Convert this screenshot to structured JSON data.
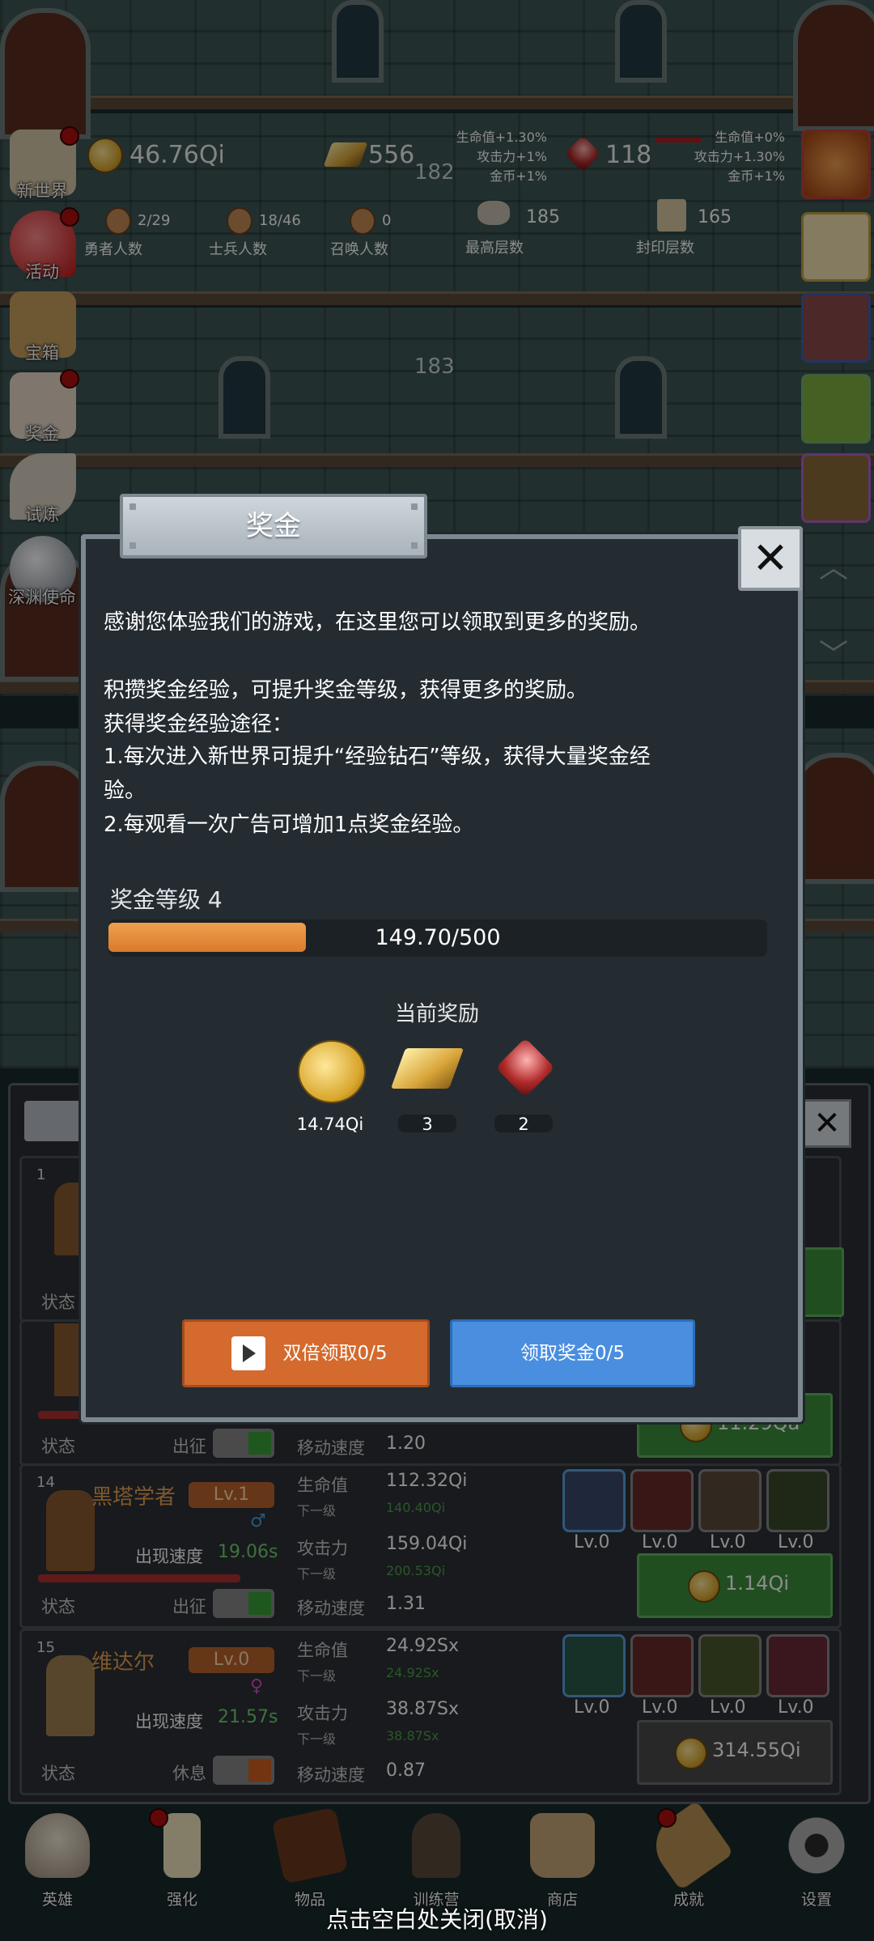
{
  "top_stats": {
    "coins": "46.76Qi",
    "gold_bars": "556",
    "rubies": "118",
    "floor_top": "182",
    "floor_mid": "183",
    "boost_left": [
      "生命值+1.30%",
      "攻击力+1%",
      "金币+1%"
    ],
    "boost_right": [
      "生命值+0%",
      "攻击力+1.30%",
      "金币+1%"
    ],
    "counters": [
      {
        "value": "2/29",
        "label": "勇者人数"
      },
      {
        "value": "18/46",
        "label": "士兵人数"
      },
      {
        "value": "0",
        "label": "召唤人数"
      },
      {
        "value": "185",
        "label": "最高层数"
      },
      {
        "value": "165",
        "label": "封印层数"
      }
    ]
  },
  "side_menu": [
    {
      "label": "新世界",
      "icon": "new-world-icon"
    },
    {
      "label": "活动",
      "icon": "heart-icon"
    },
    {
      "label": "宝箱",
      "icon": "chest-icon"
    },
    {
      "label": "奖金",
      "icon": "envelope-icon"
    },
    {
      "label": "试炼",
      "icon": "feather-icon"
    },
    {
      "label": "深渊使命",
      "icon": "orb-icon"
    }
  ],
  "modal": {
    "title": "奖金",
    "desc1": "感谢您体验我们的游戏，在这里您可以领取到更多的奖励。",
    "desc2": "积攒奖金经验，可提升奖金等级，获得更多的奖励。",
    "desc3": "获得奖金经验途径：",
    "desc4": "1.每次进入新世界可提升“经验钻石”等级，获得大量奖金经",
    "desc5": "验。",
    "desc6": "2.每观看一次广告可增加1点奖金经验。",
    "level_label": "奖金等级 4",
    "progress_current": 149.7,
    "progress_max": 500,
    "progress_text": "149.70/500",
    "reward_title": "当前奖励",
    "rewards": [
      {
        "icon": "coin-icon",
        "value": "14.74Qi"
      },
      {
        "icon": "gold-bar-icon",
        "value": "3"
      },
      {
        "icon": "ruby-icon",
        "value": "2"
      }
    ],
    "btn_double": "双倍领取0/5",
    "btn_claim": "领取奖金0/5"
  },
  "heroes": [
    {
      "index": "1",
      "status": "状态"
    },
    {
      "status": "状态",
      "action": "出征",
      "move_label": "移动速度",
      "move": "1.20",
      "cost": "11.29Qa"
    },
    {
      "index": "14",
      "name": "黑塔学者",
      "level": "Lv.1",
      "speed_label": "出现速度",
      "speed": "19.06s",
      "hp_label": "生命值",
      "hp": "112.32Qi",
      "next_label": "下一级",
      "hp_next": "140.40Qi",
      "atk_label": "攻击力",
      "atk": "159.04Qi",
      "atk_next": "200.53Qi",
      "move_label": "移动速度",
      "move": "1.31",
      "status": "状态",
      "action": "出征",
      "cost": "1.14Qi",
      "skills": [
        "Lv.0",
        "Lv.0",
        "Lv.0",
        "Lv.0"
      ]
    },
    {
      "index": "15",
      "name": "维达尔",
      "level": "Lv.0",
      "speed_label": "出现速度",
      "speed": "21.57s",
      "hp_label": "生命值",
      "hp": "24.92Sx",
      "next_label": "下一级",
      "hp_next": "24.92Sx",
      "atk_label": "攻击力",
      "atk": "38.87Sx",
      "atk_next": "38.87Sx",
      "move_label": "移动速度",
      "move": "0.87",
      "status": "状态",
      "action": "休息",
      "cost": "314.55Qi",
      "skills": [
        "Lv.0",
        "Lv.0",
        "Lv.0",
        "Lv.0"
      ]
    }
  ],
  "bottom_nav": [
    {
      "label": "英雄",
      "icon": "skull-icon"
    },
    {
      "label": "强化",
      "icon": "candle-icon"
    },
    {
      "label": "物品",
      "icon": "book-icon"
    },
    {
      "label": "训练营",
      "icon": "lantern-icon"
    },
    {
      "label": "商店",
      "icon": "mug-icon"
    },
    {
      "label": "成就",
      "icon": "key-icon"
    },
    {
      "label": "设置",
      "icon": "gear-icon"
    }
  ],
  "hint": "点击空白处关闭(取消)",
  "colors": {
    "accent_orange": "#d46a2e",
    "accent_blue": "#4a8ee0",
    "progress": "#e58a3a",
    "green": "#3c8f3c"
  }
}
